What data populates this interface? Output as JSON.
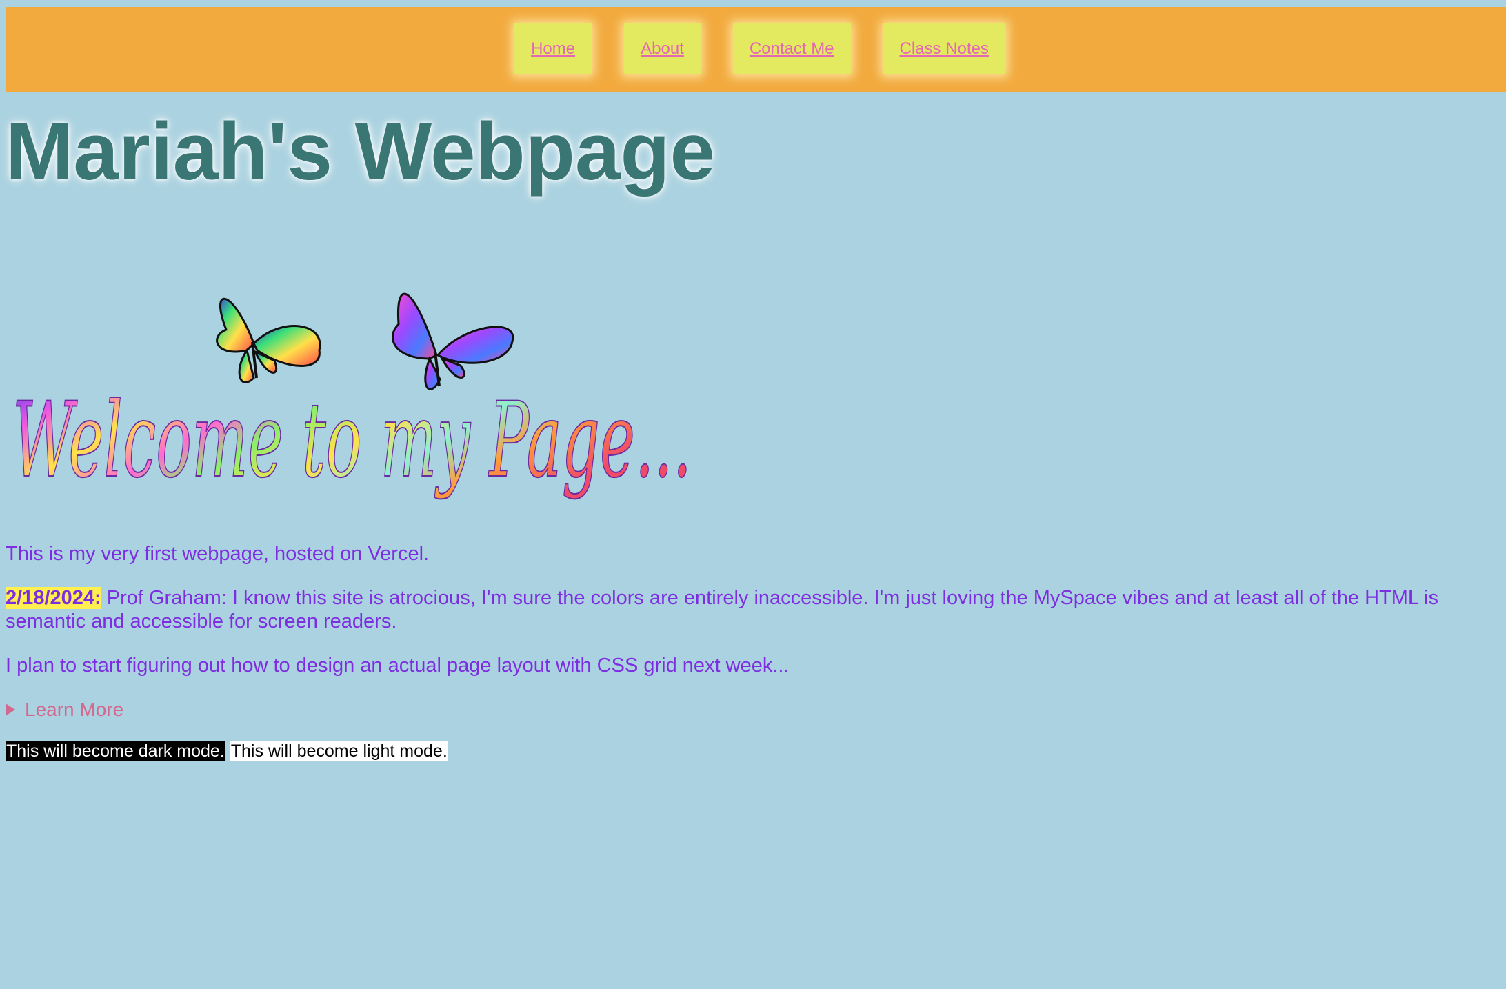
{
  "nav": {
    "items": [
      {
        "label": "Home"
      },
      {
        "label": "About"
      },
      {
        "label": "Contact Me"
      },
      {
        "label": "Class Notes"
      }
    ]
  },
  "page": {
    "title": "Mariah's Webpage"
  },
  "banner": {
    "text": "Welcome to my Page...",
    "icons": [
      "butterfly-icon",
      "butterfly-icon"
    ]
  },
  "content": {
    "intro": "This is my very first webpage, hosted on Vercel.",
    "update_date": "2/18/2024:",
    "update_text": " Prof Graham: I know this site is atrocious, I'm sure the colors are entirely inaccessible. I'm just loving the MySpace vibes and at least all of the HTML is semantic and accessible for screen readers.",
    "plan": "I plan to start figuring out how to design an actual page layout with CSS grid next week...",
    "learn_more": "Learn More",
    "dark_mode": "This will become dark mode.",
    "light_mode": "This will become light mode."
  },
  "colors": {
    "background": "#abd2e0",
    "navbar": "#f2aa3f",
    "nav_button": "#e3ea5f",
    "nav_link": "#e466b6",
    "title": "#3a7674",
    "text": "#7d2ee0",
    "highlight": "#fff04f",
    "details": "#d4698f"
  }
}
